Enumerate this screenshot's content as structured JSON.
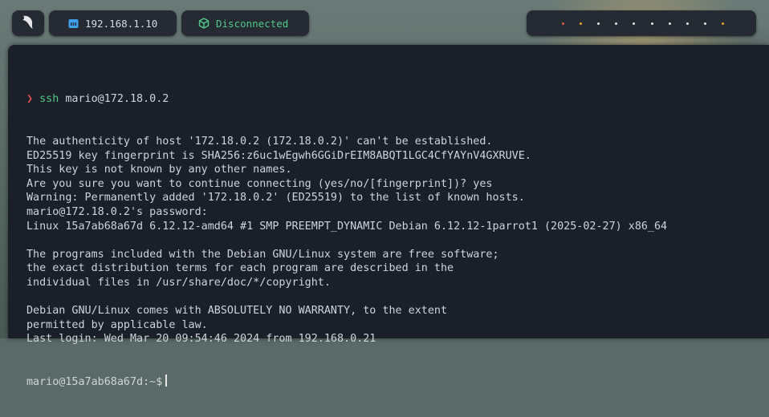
{
  "topbar": {
    "menu_icon": "parrot-icon",
    "ip_icon": "ethernet-icon",
    "ip_label": "192.168.1.10",
    "vpn_icon": "cube-icon",
    "vpn_label": "Disconnected",
    "workspaces": [
      {
        "state": "active",
        "color": "#e05a4a"
      },
      {
        "state": "occupied",
        "color": "#e0a33a"
      },
      {
        "state": "empty",
        "color": "#e6e6e6"
      },
      {
        "state": "empty",
        "color": "#e6e6e6"
      },
      {
        "state": "empty",
        "color": "#e6e6e6"
      },
      {
        "state": "empty",
        "color": "#e6e6e6"
      },
      {
        "state": "empty",
        "color": "#e6e6e6"
      },
      {
        "state": "empty",
        "color": "#e6e6e6"
      },
      {
        "state": "empty",
        "color": "#e6e6e6"
      },
      {
        "state": "occupied",
        "color": "#e0a33a"
      }
    ]
  },
  "terminal": {
    "prompt_symbol": "❯",
    "command_name": "ssh",
    "command_args": " mario@172.18.0.2",
    "output": [
      "The authenticity of host '172.18.0.2 (172.18.0.2)' can't be established.",
      "ED25519 key fingerprint is SHA256:z6uc1wEgwh6GGiDrEIM8ABQT1LGC4CfYAYnV4GXRUVE.",
      "This key is not known by any other names.",
      "Are you sure you want to continue connecting (yes/no/[fingerprint])? yes",
      "Warning: Permanently added '172.18.0.2' (ED25519) to the list of known hosts.",
      "mario@172.18.0.2's password:",
      "Linux 15a7ab68a67d 6.12.12-amd64 #1 SMP PREEMPT_DYNAMIC Debian 6.12.12-1parrot1 (2025-02-27) x86_64",
      "",
      "The programs included with the Debian GNU/Linux system are free software;",
      "the exact distribution terms for each program are described in the",
      "individual files in /usr/share/doc/*/copyright.",
      "",
      "Debian GNU/Linux comes with ABSOLUTELY NO WARRANTY, to the extent",
      "permitted by applicable law.",
      "Last login: Wed Mar 20 09:54:46 2024 from 192.168.0.21"
    ],
    "shell_prompt": "mario@15a7ab68a67d:~$"
  }
}
